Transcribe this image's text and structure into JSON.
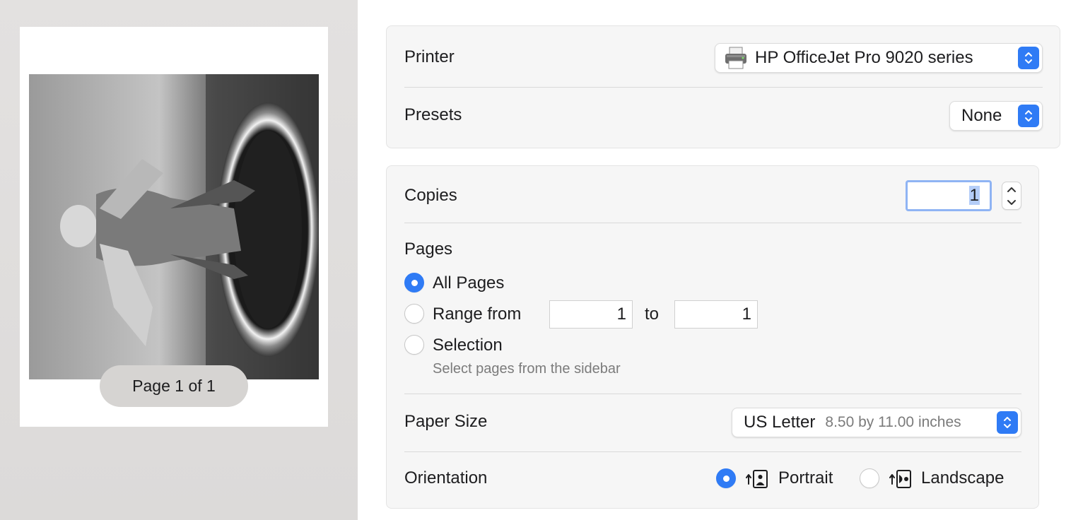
{
  "preview": {
    "page_indicator": "Page 1 of 1"
  },
  "printer_group": {
    "printer_label": "Printer",
    "printer_value": "HP OfficeJet Pro 9020 series",
    "presets_label": "Presets",
    "presets_value": "None"
  },
  "copies_group": {
    "copies_label": "Copies",
    "copies_value": "1",
    "pages_label": "Pages",
    "all_pages_label": "All Pages",
    "range_from_label": "Range from",
    "range_from_value": "1",
    "range_to_label": "to",
    "range_to_value": "1",
    "selection_label": "Selection",
    "selection_hint": "Select pages from the sidebar",
    "page_option_selected": "All Pages",
    "paper_size_label": "Paper Size",
    "paper_size_value": "US Letter",
    "paper_size_detail": "8.50 by 11.00 inches",
    "orientation_label": "Orientation",
    "portrait_label": "Portrait",
    "landscape_label": "Landscape",
    "orientation_selected": "Portrait"
  },
  "colors": {
    "accent": "#2f7bf5",
    "focus_ring": "#8fb4f4",
    "text_selection": "#b4cdf8"
  },
  "icons": [
    "printer-icon",
    "chevrons-updown-icon",
    "portrait-orientation-icon",
    "landscape-orientation-icon",
    "chevron-up-icon",
    "chevron-down-icon"
  ]
}
